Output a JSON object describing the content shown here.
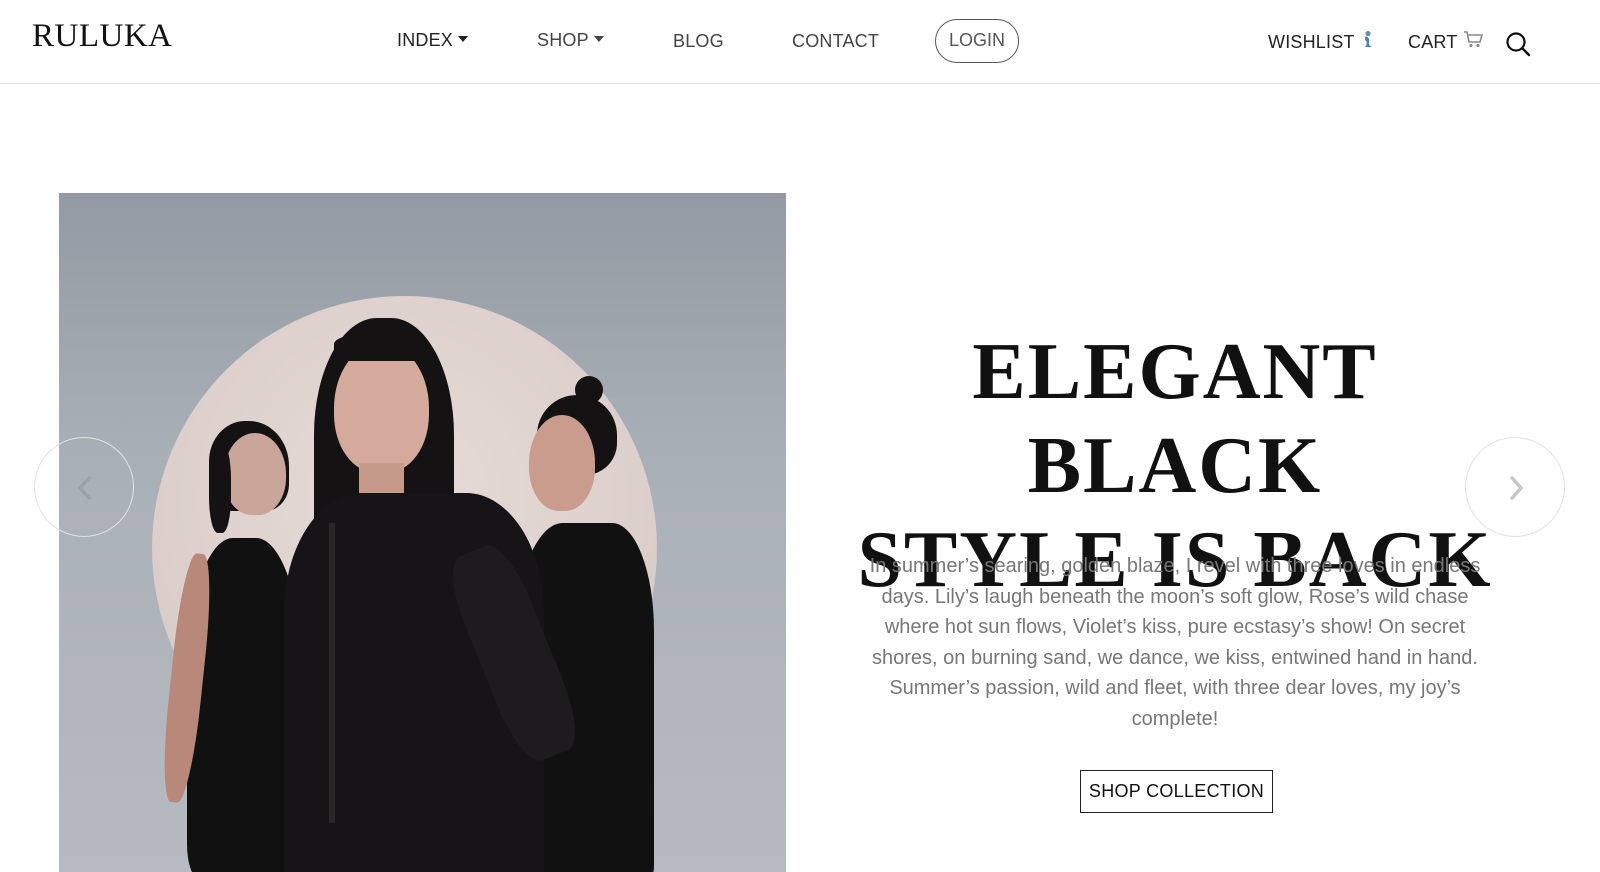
{
  "brand": {
    "logo_text": "RULUKA"
  },
  "nav": {
    "items": [
      {
        "label": "INDEX",
        "has_dropdown": true
      },
      {
        "label": "SHOP",
        "has_dropdown": true
      },
      {
        "label": "BLOG",
        "has_dropdown": false
      },
      {
        "label": "CONTACT",
        "has_dropdown": false
      }
    ],
    "login_label": "LOGIN",
    "wishlist_label": "WISHLIST",
    "wishlist_icon": "mermaid-icon",
    "cart_label": "CART",
    "cart_icon": "cart-icon",
    "search_icon": "search-icon"
  },
  "hero": {
    "headline_line1": "ELEGANT BLACK",
    "headline_line2": "STYLE IS BACK",
    "paragraph": "In summer’s searing, golden blaze, I revel with three loves in endless days. Lily’s laugh beneath the moon’s soft glow, Rose’s wild chase where hot sun flows, Violet’s kiss, pure ecstasy’s show! On secret shores, on burning sand, we dance, we kiss, entwined hand in hand. Summer’s passion, wild and fleet, with three dear loves, my joy’s complete!",
    "cta_label": "SHOP COLLECTION",
    "prev_icon": "chevron-left-icon",
    "next_icon": "chevron-right-icon"
  },
  "colors": {
    "text": "#111111",
    "muted_text": "#777777",
    "border": "#e6e6e6",
    "image_bg": "#a8aeb5"
  }
}
